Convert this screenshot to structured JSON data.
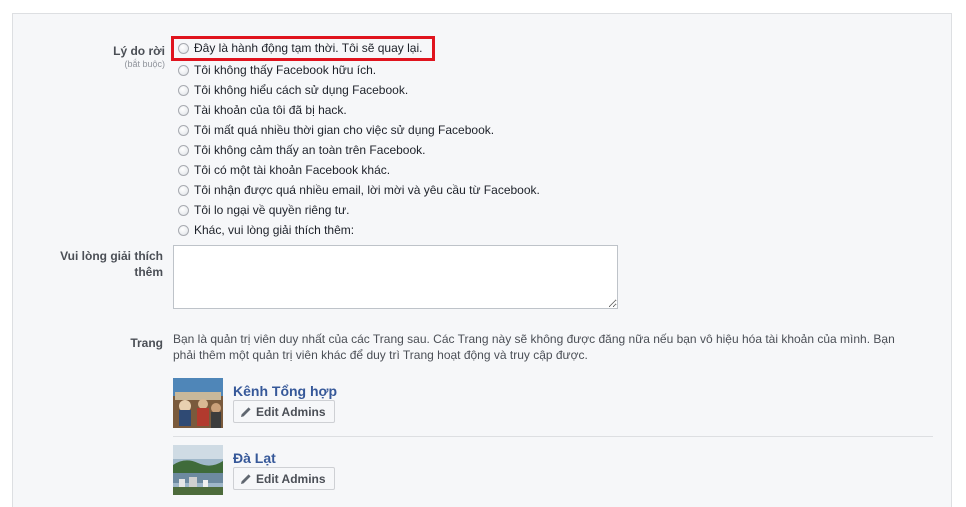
{
  "form": {
    "reason_label": "Lý do rời",
    "reason_required": "(bắt buộc)",
    "reasons": [
      "Đây là hành động tạm thời. Tôi sẽ quay lại.",
      "Tôi không thấy Facebook hữu ích.",
      "Tôi không hiểu cách sử dụng Facebook.",
      "Tài khoản của tôi đã bị hack.",
      "Tôi mất quá nhiều thời gian cho việc sử dụng Facebook.",
      "Tôi không cảm thấy an toàn trên Facebook.",
      "Tôi có một tài khoản Facebook khác.",
      "Tôi nhận được quá nhiều email, lời mời và yêu cầu từ Facebook.",
      "Tôi lo ngại về quyền riêng tư.",
      "Khác, vui lòng giải thích thêm:"
    ],
    "explain_label_line1": "Vui lòng giải thích",
    "explain_label_line2": "thêm",
    "explain_value": "",
    "pages_label": "Trang",
    "pages_description": "Bạn là quản trị viên duy nhất của các Trang sau. Các Trang này sẽ không được đăng nữa nếu bạn vô hiệu hóa tài khoản của mình. Bạn phải thêm một quản trị viên khác để duy trì Trang hoạt động và truy cập được.",
    "pages": [
      {
        "name": "Kênh Tổng hợp",
        "edit_label": "Edit Admins"
      },
      {
        "name": "Đà Lạt",
        "edit_label": "Edit Admins"
      }
    ]
  },
  "colors": {
    "highlight": "#e0141e",
    "link": "#365899",
    "panel_bg": "#f6f7f9"
  },
  "icons": [
    "pencil-icon"
  ]
}
